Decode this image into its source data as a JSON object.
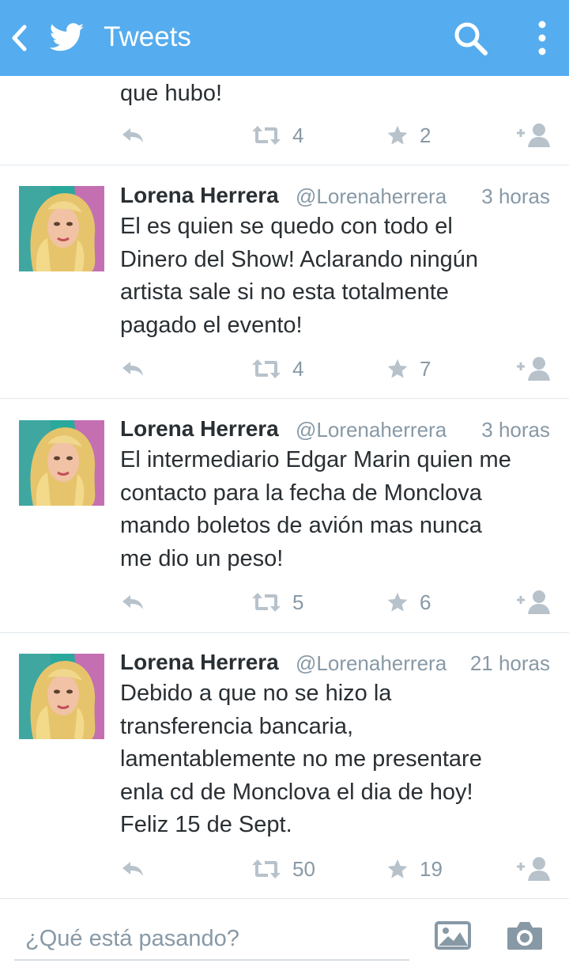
{
  "header": {
    "title": "Tweets"
  },
  "partial_tweet": {
    "text": "que hubo!",
    "retweets": "4",
    "favorites": "2"
  },
  "tweets": [
    {
      "name": "Lorena Herrera",
      "handle": "@Lorenaherrera",
      "time": "3 horas",
      "text": "El es quien se quedo con todo el\nDinero del Show! Aclarando ningún\nartista sale si no esta totalmente\npagado el evento!",
      "retweets": "4",
      "favorites": "7"
    },
    {
      "name": "Lorena Herrera",
      "handle": "@Lorenaherrera",
      "time": "3 horas",
      "text": "El intermediario Edgar Marin quien me\ncontacto para la fecha de Monclova\nmando boletos de avión mas nunca\nme dio un peso!",
      "retweets": "5",
      "favorites": "6"
    },
    {
      "name": "Lorena Herrera",
      "handle": "@Lorenaherrera",
      "time": "21 horas",
      "text": "Debido a que no se hizo la\ntransferencia bancaria,\nlamentablemente no me presentare\nenla cd de Monclova el dia de hoy!\nFeliz 15 de Sept.",
      "retweets": "50",
      "favorites": "19"
    }
  ],
  "composer": {
    "placeholder": "¿Qué está pasando?"
  },
  "colors": {
    "brand": "#55acee",
    "action_icon": "#b7c2cb",
    "text": "#292f33",
    "muted": "#8899a6"
  },
  "icons": [
    "back-icon",
    "twitter-bird-icon",
    "search-icon",
    "overflow-menu-icon",
    "reply-icon",
    "retweet-icon",
    "favorite-star-icon",
    "follow-icon",
    "photo-icon",
    "camera-icon"
  ]
}
